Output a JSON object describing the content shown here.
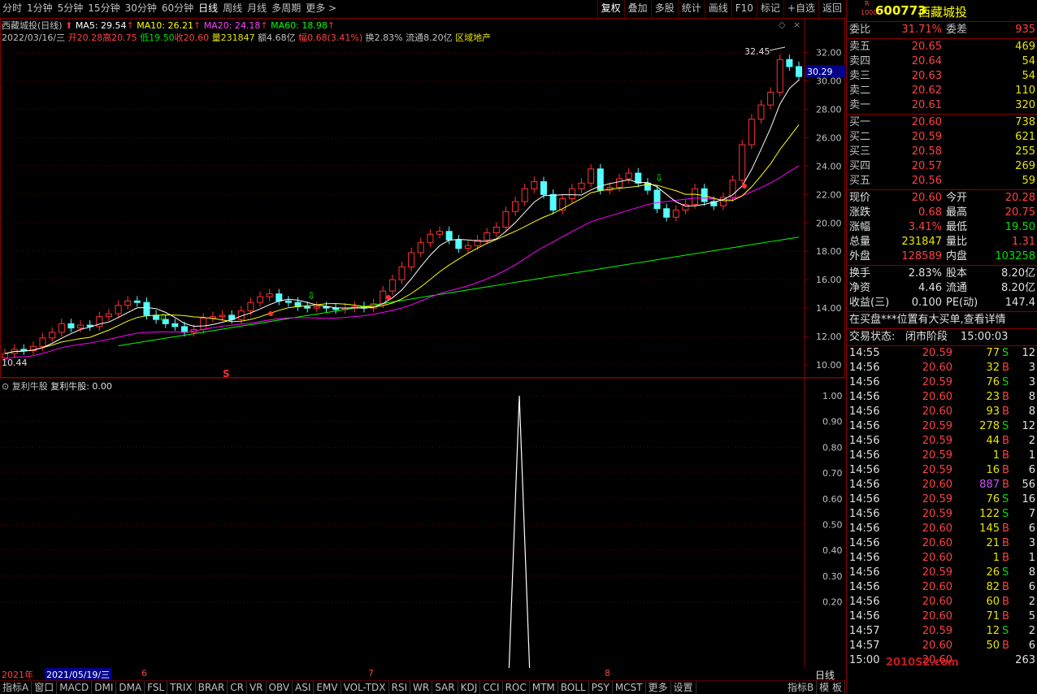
{
  "toolbar": {
    "periods": [
      "分时",
      "1分钟",
      "5分钟",
      "15分钟",
      "30分钟",
      "60分钟",
      "日线",
      "周线",
      "月线",
      "多周期",
      "更多 >"
    ],
    "active_period": "日线",
    "right_buttons": [
      "复权",
      "叠加",
      "多股",
      "统计",
      "画线",
      "F10",
      "标记",
      "+自选",
      "返回"
    ]
  },
  "chart": {
    "title": "西藏城投(日线)",
    "ma5": "MA5: 29.54",
    "ma10": "MA10: 26.21",
    "ma20": "MA20: 24.18",
    "ma60": "MA60: 18.98",
    "info_date": "2022/03/16/三",
    "info_open": "开20.28",
    "info_high": "高20.75",
    "info_low": "低19.50",
    "info_close": "收20.60",
    "info_vol": "量231847",
    "info_amount": "额4.68亿",
    "info_range": "幅0.68(3.41%)",
    "info_turnover": "换2.83%",
    "info_float": "流通8.20亿",
    "info_sector": "区域地产",
    "high_label": "32.45",
    "low_label": "10.44",
    "current_price_tag": "30.29",
    "s_marker": "S",
    "y_ticks": [
      "32.00",
      "30.00",
      "28.00",
      "26.00",
      "24.00",
      "22.00",
      "20.00",
      "18.00",
      "16.00",
      "14.00",
      "12.00",
      "10.00"
    ],
    "colors": {
      "up": "#ff3232",
      "down": "#54ffff",
      "ma5": "#ffffff",
      "ma10": "#ffff00",
      "ma20": "#ff00ff",
      "ma60": "#00ff00"
    }
  },
  "indicator": {
    "title": "复利牛股",
    "value": "复利牛股: 0.00",
    "y_ticks": [
      "1.00",
      "0.90",
      "0.80",
      "0.70",
      "0.60",
      "0.50",
      "0.40",
      "0.30",
      "0.20"
    ]
  },
  "date_axis": {
    "year": "2021年",
    "cursor_date": "2021/05/19/三",
    "months": [
      "6",
      "7",
      "8"
    ],
    "period_label": "日线"
  },
  "bottom_tabs": [
    "指标A",
    "窗口",
    "MACD",
    "DMI",
    "DMA",
    "FSL",
    "TRIX",
    "BRAR",
    "CR",
    "VR",
    "OBV",
    "ASI",
    "EMV",
    "VOL-TDX",
    "RSI",
    "WR",
    "SAR",
    "KDJ",
    "CCI",
    "ROC",
    "MTM",
    "BOLL",
    "PSY",
    "MCST",
    "更多",
    "设置"
  ],
  "bottom_right_tabs": [
    "指标B",
    "模 板"
  ],
  "stock": {
    "code": "600773",
    "name": "西藏城投",
    "badge_top": "R",
    "badge_bottom": "1000"
  },
  "order_book": {
    "wei_bi_label": "委比",
    "wei_bi": "31.71%",
    "wei_cha_label": "委差",
    "wei_cha": "935",
    "sells": [
      {
        "label": "卖五",
        "price": "20.65",
        "vol": "469"
      },
      {
        "label": "卖四",
        "price": "20.64",
        "vol": "54"
      },
      {
        "label": "卖三",
        "price": "20.63",
        "vol": "54"
      },
      {
        "label": "卖二",
        "price": "20.62",
        "vol": "110"
      },
      {
        "label": "卖一",
        "price": "20.61",
        "vol": "320"
      }
    ],
    "buys": [
      {
        "label": "买一",
        "price": "20.60",
        "vol": "738"
      },
      {
        "label": "买二",
        "price": "20.59",
        "vol": "621"
      },
      {
        "label": "买三",
        "price": "20.58",
        "vol": "255"
      },
      {
        "label": "买四",
        "price": "20.57",
        "vol": "269"
      },
      {
        "label": "买五",
        "price": "20.56",
        "vol": "59"
      }
    ]
  },
  "quote": {
    "rows": [
      {
        "l1": "现价",
        "v1": "20.60",
        "l2": "今开",
        "v2": "20.28"
      },
      {
        "l1": "涨跌",
        "v1": "0.68",
        "l2": "最高",
        "v2": "20.75"
      },
      {
        "l1": "涨幅",
        "v1": "3.41%",
        "l2": "最低",
        "v2": "19.50"
      },
      {
        "l1": "总量",
        "v1": "231847",
        "l2": "量比",
        "v2": "1.31"
      },
      {
        "l1": "外盘",
        "v1": "128589",
        "l2": "内盘",
        "v2": "103258"
      }
    ],
    "rows2": [
      {
        "l1": "换手",
        "v1": "2.83%",
        "l2": "股本",
        "v2": "8.20亿"
      },
      {
        "l1": "净资",
        "v1": "4.46",
        "l2": "流通",
        "v2": "8.20亿"
      },
      {
        "l1": "收益(三)",
        "v1": "0.100",
        "l2": "PE(动)",
        "v2": "147.4"
      }
    ],
    "notice": "在买盘***位置有大买单,查看详情",
    "status_label": "交易状态:",
    "status": "闭市阶段",
    "status_time": "15:00:03"
  },
  "ticks": [
    {
      "t": "14:55",
      "p": "20.59",
      "v": "77",
      "d": "S",
      "n": "12"
    },
    {
      "t": "14:56",
      "p": "20.60",
      "v": "32",
      "d": "B",
      "n": "3"
    },
    {
      "t": "14:56",
      "p": "20.59",
      "v": "76",
      "d": "S",
      "n": "3"
    },
    {
      "t": "14:56",
      "p": "20.60",
      "v": "23",
      "d": "B",
      "n": "8"
    },
    {
      "t": "14:56",
      "p": "20.60",
      "v": "93",
      "d": "B",
      "n": "8"
    },
    {
      "t": "14:56",
      "p": "20.59",
      "v": "278",
      "d": "S",
      "n": "12"
    },
    {
      "t": "14:56",
      "p": "20.59",
      "v": "44",
      "d": "B",
      "n": "2"
    },
    {
      "t": "14:56",
      "p": "20.59",
      "v": "1",
      "d": "B",
      "n": "1"
    },
    {
      "t": "14:56",
      "p": "20.59",
      "v": "16",
      "d": "B",
      "n": "6"
    },
    {
      "t": "14:56",
      "p": "20.60",
      "v": "887",
      "d": "B",
      "n": "56"
    },
    {
      "t": "14:56",
      "p": "20.59",
      "v": "76",
      "d": "S",
      "n": "16"
    },
    {
      "t": "14:56",
      "p": "20.59",
      "v": "122",
      "d": "S",
      "n": "7"
    },
    {
      "t": "14:56",
      "p": "20.60",
      "v": "145",
      "d": "B",
      "n": "6"
    },
    {
      "t": "14:56",
      "p": "20.60",
      "v": "21",
      "d": "B",
      "n": "3"
    },
    {
      "t": "14:56",
      "p": "20.60",
      "v": "1",
      "d": "B",
      "n": "1"
    },
    {
      "t": "14:56",
      "p": "20.59",
      "v": "26",
      "d": "S",
      "n": "8"
    },
    {
      "t": "14:56",
      "p": "20.60",
      "v": "82",
      "d": "B",
      "n": "6"
    },
    {
      "t": "14:56",
      "p": "20.60",
      "v": "60",
      "d": "B",
      "n": "2"
    },
    {
      "t": "14:56",
      "p": "20.60",
      "v": "71",
      "d": "B",
      "n": "5"
    },
    {
      "t": "14:57",
      "p": "20.59",
      "v": "12",
      "d": "S",
      "n": "2"
    },
    {
      "t": "14:57",
      "p": "20.60",
      "v": "50",
      "d": "B",
      "n": "6"
    },
    {
      "t": "15:00",
      "p": "20.60",
      "v": "",
      "d": "",
      "n": "263"
    }
  ],
  "watermark": "2010S2.com"
}
